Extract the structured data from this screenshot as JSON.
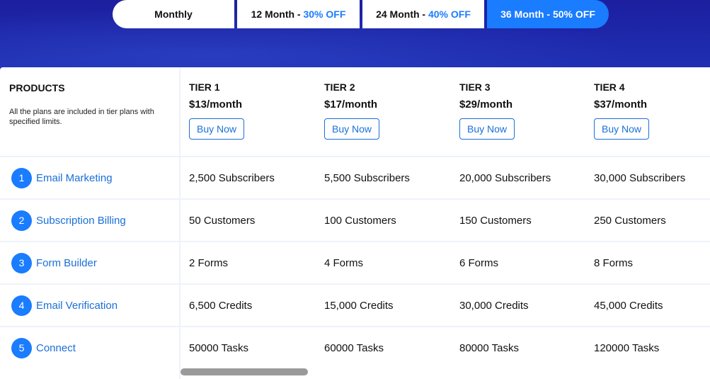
{
  "billing_toggle": [
    {
      "label": "Monthly",
      "discount": ""
    },
    {
      "label": "12 Month - ",
      "discount": "30% OFF"
    },
    {
      "label": "24 Month - ",
      "discount": "40% OFF"
    },
    {
      "label": "36 Month - 50% OFF",
      "discount": ""
    }
  ],
  "products": {
    "title": "PRODUCTS",
    "description": "All the plans are included in tier plans with specified limits."
  },
  "tiers": [
    {
      "name": "TIER 1",
      "price": "$13/month",
      "button": "Buy Now"
    },
    {
      "name": "TIER 2",
      "price": "$17/month",
      "button": "Buy Now"
    },
    {
      "name": "TIER 3",
      "price": "$29/month",
      "button": "Buy Now"
    },
    {
      "name": "TIER 4",
      "price": "$37/month",
      "button": "Buy Now"
    }
  ],
  "features": [
    {
      "num": "1",
      "label": "Email Marketing",
      "values": [
        "2,500 Subscribers",
        "5,500 Subscribers",
        "20,000 Subscribers",
        "30,000 Subscribers"
      ]
    },
    {
      "num": "2",
      "label": "Subscription Billing",
      "values": [
        "50 Customers",
        "100 Customers",
        "150 Customers",
        "250 Customers"
      ]
    },
    {
      "num": "3",
      "label": "Form Builder",
      "values": [
        "2 Forms",
        "4 Forms",
        "6 Forms",
        "8 Forms"
      ]
    },
    {
      "num": "4",
      "label": "Email Verification",
      "values": [
        "6,500 Credits",
        "15,000 Credits",
        "30,000 Credits",
        "45,000 Credits"
      ]
    },
    {
      "num": "5",
      "label": "Connect",
      "values": [
        "50000 Tasks",
        "60000 Tasks",
        "80000 Tasks",
        "120000 Tasks"
      ]
    }
  ],
  "colors": {
    "accent": "#1a7cff",
    "link": "#1a6fd8",
    "hero": "#1c1f9f"
  }
}
